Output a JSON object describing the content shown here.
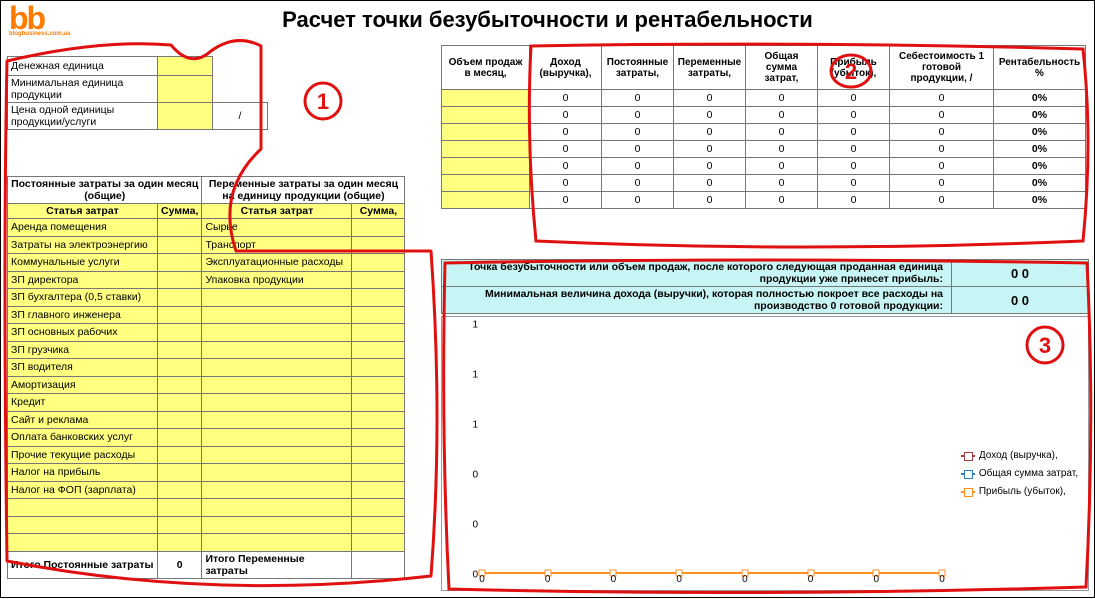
{
  "title": "Расчет точки безубыточности и рентабельности",
  "logo": {
    "big": "bb",
    "small": "blogbusiness.com.ua"
  },
  "params": {
    "currency_label": "Денежная единица",
    "min_unit_label": "Минимальная единица продукции",
    "unit_price_label": "Цена одной единицы продукции/услуги",
    "slash": "/"
  },
  "annotations": {
    "n1": "1",
    "n2": "2",
    "n3": "3"
  },
  "costs": {
    "fixed_header": "Постоянные затраты за один месяц (общие)",
    "variable_header": "Переменные затраты за один месяц на единицу продукции (общие)",
    "col_item": "Статья затрат",
    "col_sum": "Сумма,",
    "fixed_items": [
      "Аренда помещения",
      "Затраты на электроэнергию",
      "Коммунальные услуги",
      "ЗП директора",
      "ЗП бухгалтера (0,5 ставки)",
      "ЗП главного инженера",
      "ЗП основных рабочих",
      "ЗП грузчика",
      "ЗП водителя",
      "Амортизация",
      "Кредит",
      "Сайт и реклама",
      "Оплата банковских услуг",
      "Прочие текущие расходы",
      "Налог на прибыль",
      "Налог на ФОП (зарплата)",
      "",
      "",
      ""
    ],
    "variable_items": [
      "Сырье",
      "Транспорт",
      "Эксплуатационные расходы",
      "Упаковка продукции",
      "",
      "",
      "",
      "",
      "",
      "",
      "",
      "",
      "",
      "",
      "",
      "",
      "",
      "",
      ""
    ],
    "fixed_total_label": "Итого Постоянные затраты",
    "fixed_total_value": "0",
    "variable_total_label": "Итого Переменные затраты",
    "variable_total_value": ""
  },
  "results": {
    "headers": [
      "Объем продаж в месяц,",
      "Доход (выручка),",
      "Постоянные затраты,",
      "Переменные затраты,",
      "Общая сумма затрат,",
      "Прибыль (убыток),",
      "Себестоимость 1 готовой продукции, /",
      "Рентабельность %"
    ],
    "rows": [
      [
        "",
        "0",
        "0",
        "0",
        "0",
        "0",
        "0",
        "0%"
      ],
      [
        "",
        "0",
        "0",
        "0",
        "0",
        "0",
        "0",
        "0%"
      ],
      [
        "",
        "0",
        "0",
        "0",
        "0",
        "0",
        "0",
        "0%"
      ],
      [
        "",
        "0",
        "0",
        "0",
        "0",
        "0",
        "0",
        "0%"
      ],
      [
        "",
        "0",
        "0",
        "0",
        "0",
        "0",
        "0",
        "0%"
      ],
      [
        "",
        "0",
        "0",
        "0",
        "0",
        "0",
        "0",
        "0%"
      ],
      [
        "",
        "0",
        "0",
        "0",
        "0",
        "0",
        "0",
        "0%"
      ]
    ]
  },
  "summary": {
    "bep_label": "Точка безубыточности или объем продаж, после которого следующая проданная единица продукции уже принесет прибыль:",
    "bep_value": "0 0",
    "minrev_label": "Минимальная величина дохода (выручки), которая полностью покроет все расходы на производство 0  готовой продукции:",
    "minrev_value": "0 0"
  },
  "chart_data": {
    "type": "line",
    "x": [
      0,
      0,
      0,
      0,
      0,
      0,
      0,
      0
    ],
    "series": [
      {
        "name": "Доход (выручка),",
        "values": [
          0,
          0,
          0,
          0,
          0,
          0,
          0,
          0
        ],
        "color": "#a04040"
      },
      {
        "name": "Общая сумма затрат,",
        "values": [
          0,
          0,
          0,
          0,
          0,
          0,
          0,
          0
        ],
        "color": "#3080c0"
      },
      {
        "name": "Прибыль (убыток),",
        "values": [
          0,
          0,
          0,
          0,
          0,
          0,
          0,
          0
        ],
        "color": "#ff9020"
      }
    ],
    "yticks": [
      0,
      0,
      0,
      1,
      1,
      1
    ],
    "ylim": [
      0,
      1
    ],
    "xlabel": "",
    "ylabel": "",
    "title": ""
  }
}
